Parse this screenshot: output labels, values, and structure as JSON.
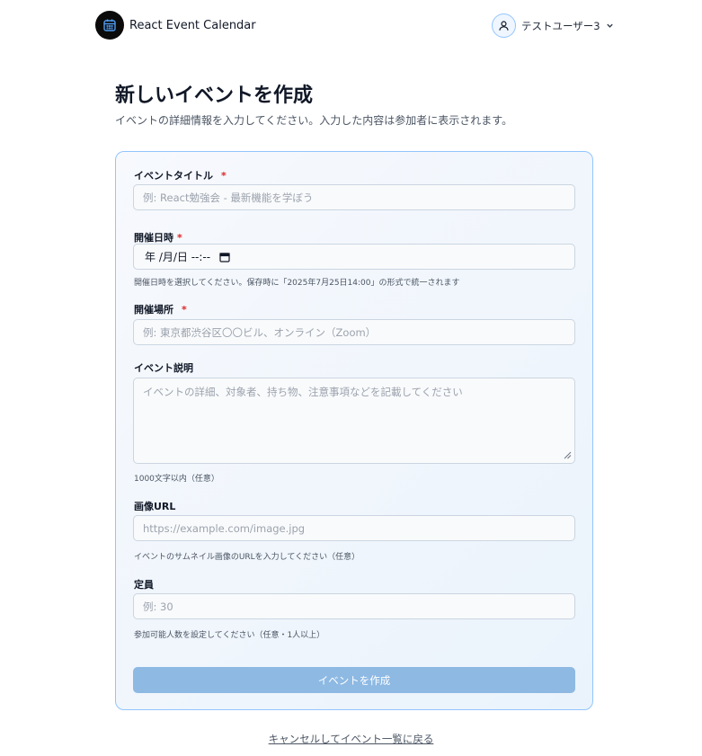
{
  "header": {
    "app_name": "React Event Calendar",
    "user_name": "テストユーザー3"
  },
  "page": {
    "title": "新しいイベントを作成",
    "subtitle": "イベントの詳細情報を入力してください。入力した内容は参加者に表示されます。"
  },
  "form": {
    "title_field": {
      "label": "イベントタイトル",
      "required_mark": "*",
      "placeholder": "例: React勉強会 - 最新機能を学ぼう"
    },
    "date_field": {
      "label": "開催日時",
      "required_mark": "*",
      "value": "年 /月/日 --:--",
      "help": "開催日時を選択してください。保存時に「2025年7月25日14:00」の形式で統一されます"
    },
    "location_field": {
      "label": "開催場所",
      "required_mark": "*",
      "placeholder": "例: 東京都渋谷区〇〇ビル、オンライン（Zoom）"
    },
    "description_field": {
      "label": "イベント説明",
      "placeholder": "イベントの詳細、対象者、持ち物、注意事項などを記載してください",
      "help": "1000文字以内（任意）"
    },
    "image_field": {
      "label": "画像URL",
      "placeholder": "https://example.com/image.jpg",
      "help": "イベントのサムネイル画像のURLを入力してください（任意）"
    },
    "capacity_field": {
      "label": "定員",
      "placeholder": "例: 30",
      "help": "参加可能人数を設定してください（任意・1人以上）"
    },
    "submit_label": "イベントを作成"
  },
  "cancel_link": "キャンセルしてイベント一覧に戻る",
  "colors": {
    "accent_border": "#93c5fd",
    "submit_disabled": "#8db9e3",
    "required": "#dc2626"
  },
  "icons": {
    "brand": "calendar-icon",
    "avatar": "user-icon",
    "dropdown": "chevron-down-icon",
    "date_picker": "calendar-picker-icon"
  }
}
